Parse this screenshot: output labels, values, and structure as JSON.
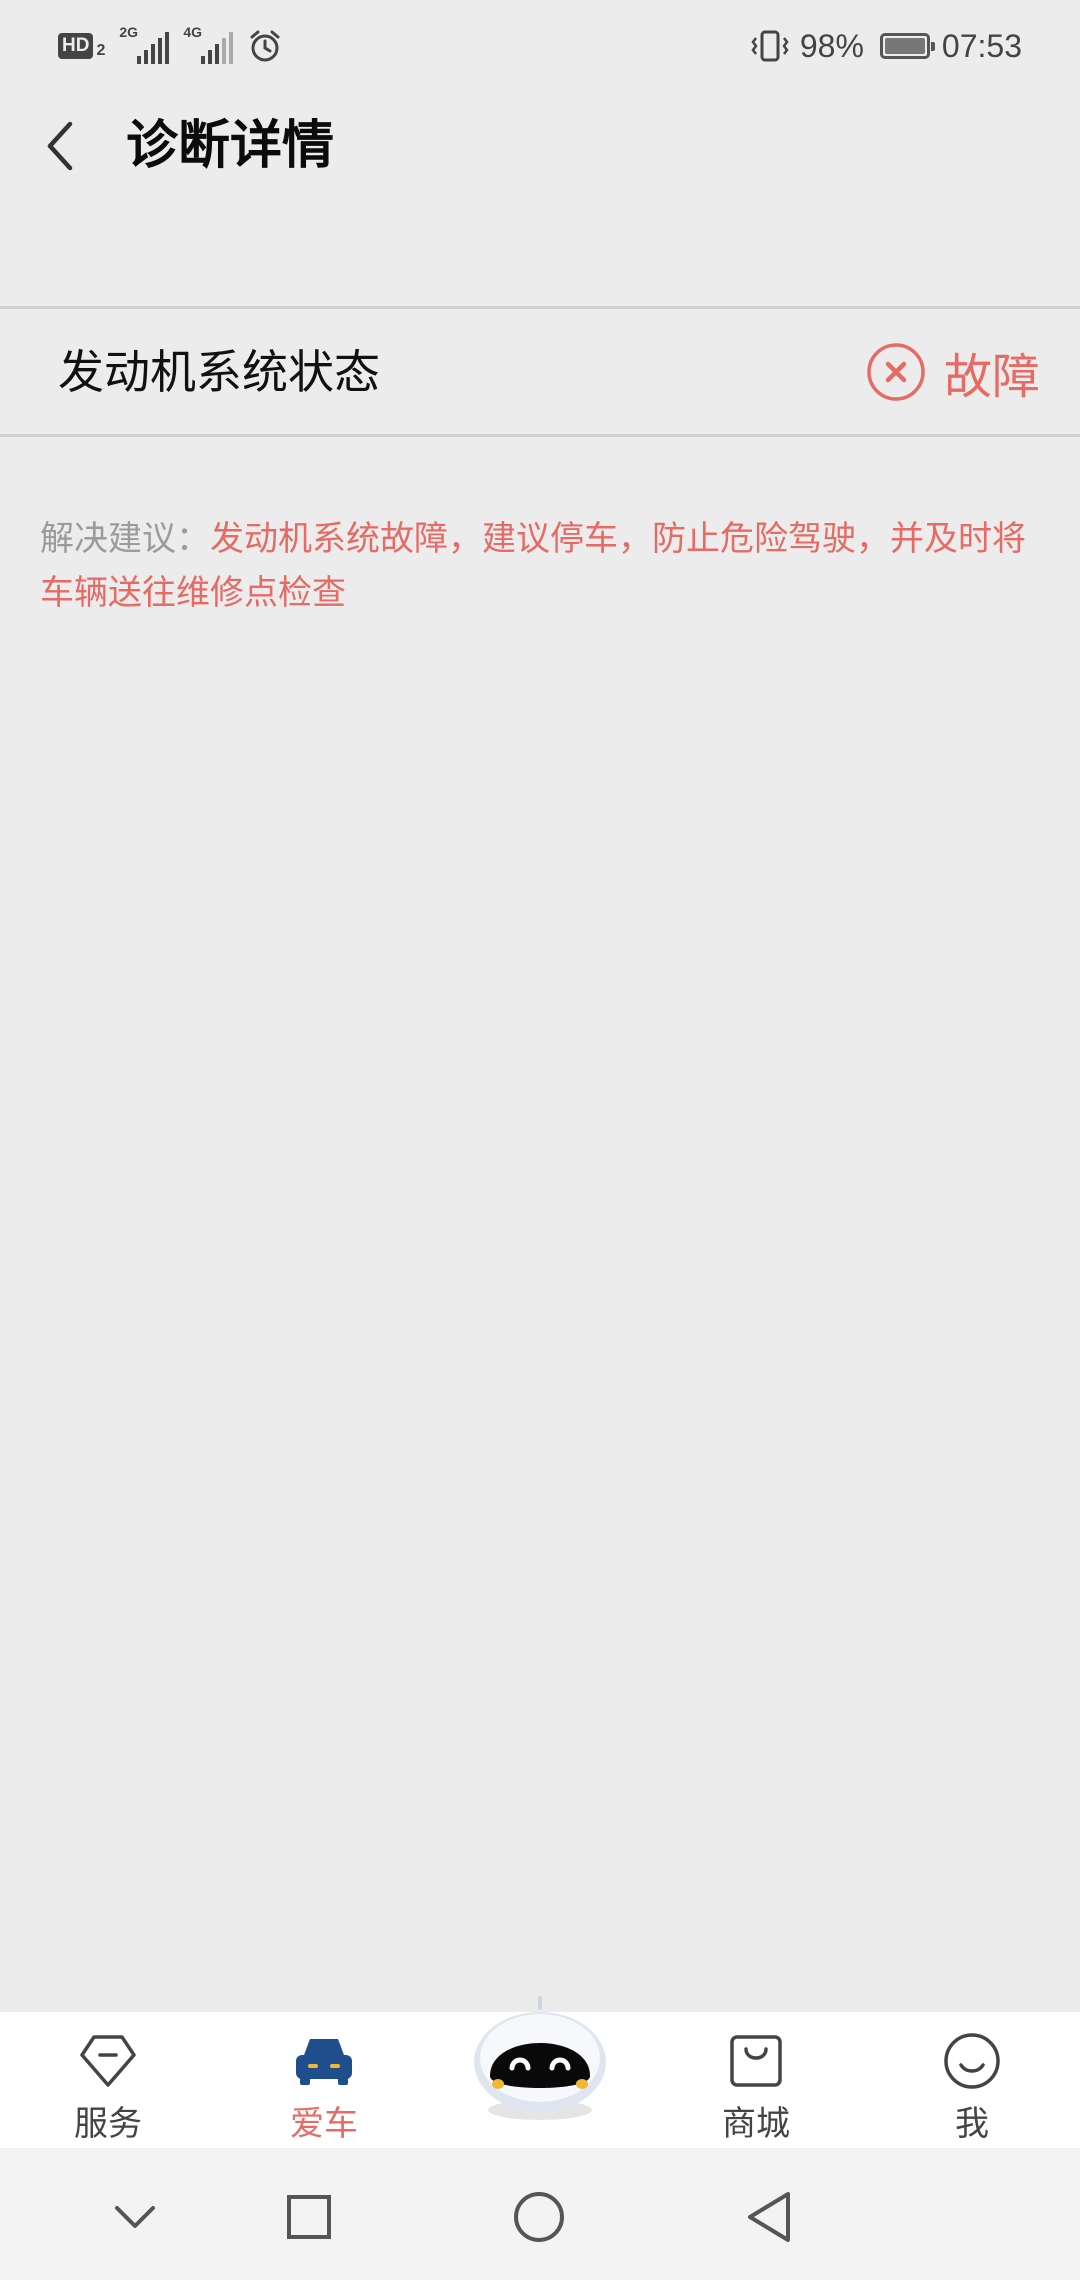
{
  "status_bar": {
    "hd_label": "HD",
    "hd_sub": "2",
    "net1": "2G",
    "net2": "4G",
    "battery_percent": "98%",
    "time": "07:53"
  },
  "header": {
    "title": "诊断详情"
  },
  "system_row": {
    "name": "发动机系统状态",
    "status": "故障"
  },
  "advice": {
    "label": "解决建议：",
    "text": "发动机系统故障，建议停车，防止危险驾驶，并及时将车辆送往维修点检查"
  },
  "bottom_nav": {
    "items": [
      {
        "label": "服务",
        "icon": "service-tag-icon"
      },
      {
        "label": "爱车",
        "icon": "car-icon",
        "active": true
      },
      {
        "label": "",
        "icon": "robot-assistant-icon"
      },
      {
        "label": "商城",
        "icon": "shopping-bag-icon"
      },
      {
        "label": "我",
        "icon": "smiley-profile-icon"
      }
    ]
  },
  "colors": {
    "accent": "#e56b64",
    "background": "#ececec",
    "car_blue": "#1e4f8c"
  }
}
